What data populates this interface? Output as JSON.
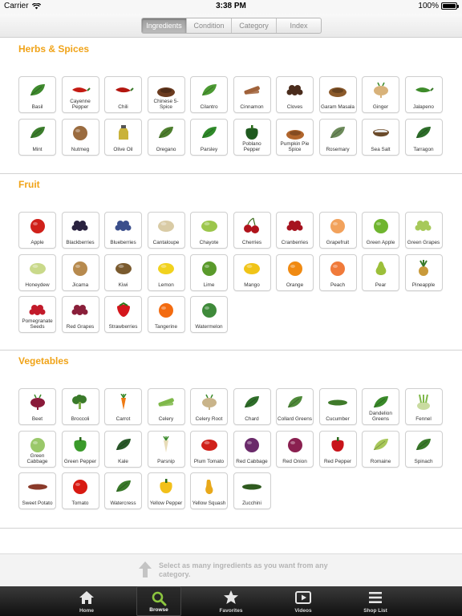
{
  "status": {
    "carrier": "Carrier",
    "time": "3:38 PM",
    "battery": "100%"
  },
  "segments": [
    {
      "label": "Ingredients",
      "active": true
    },
    {
      "label": "Condition",
      "active": false
    },
    {
      "label": "Category",
      "active": false
    },
    {
      "label": "Index",
      "active": false
    }
  ],
  "sections": [
    {
      "title": "Herbs & Spices",
      "items": [
        {
          "label": "Basil",
          "icon": "leaf",
          "color": "#3f8a2e"
        },
        {
          "label": "Cayenne Pepper",
          "icon": "chili",
          "color": "#c41a12"
        },
        {
          "label": "Chili",
          "icon": "chili",
          "color": "#b3160f"
        },
        {
          "label": "Chinese 5-Spice",
          "icon": "powder",
          "color": "#6b3b1f"
        },
        {
          "label": "Cilantro",
          "icon": "leaf",
          "color": "#4c9a33"
        },
        {
          "label": "Cinnamon",
          "icon": "stick",
          "color": "#a0623a"
        },
        {
          "label": "Cloves",
          "icon": "cluster",
          "color": "#4a2c1c"
        },
        {
          "label": "Garam Masala",
          "icon": "powder",
          "color": "#8b5a2b"
        },
        {
          "label": "Ginger",
          "icon": "root",
          "color": "#d8b27a"
        },
        {
          "label": "Jalapeno",
          "icon": "chili",
          "color": "#3d8b2a"
        },
        {
          "label": "Mint",
          "icon": "leaf",
          "color": "#3b7d2c"
        },
        {
          "label": "Nutmeg",
          "icon": "round",
          "color": "#9a6b3f"
        },
        {
          "label": "Olive Oil",
          "icon": "bottle",
          "color": "#c9b23a"
        },
        {
          "label": "Oregano",
          "icon": "leaf",
          "color": "#4e7f2f"
        },
        {
          "label": "Parsley",
          "icon": "leaf",
          "color": "#2f8a2a"
        },
        {
          "label": "Poblano Pepper",
          "icon": "pepper",
          "color": "#1f5a1f"
        },
        {
          "label": "Pumpkin Pie Spice",
          "icon": "powder",
          "color": "#b0652c"
        },
        {
          "label": "Rosemary",
          "icon": "leaf",
          "color": "#6c8a5a"
        },
        {
          "label": "Sea Salt",
          "icon": "bowl",
          "color": "#e6e6e6"
        },
        {
          "label": "Tarragon",
          "icon": "leaf",
          "color": "#2e6e2a"
        }
      ]
    },
    {
      "title": "Fruit",
      "items": [
        {
          "label": "Apple",
          "icon": "round",
          "color": "#d0211a"
        },
        {
          "label": "Blackberries",
          "icon": "cluster",
          "color": "#2a2340"
        },
        {
          "label": "Blueberries",
          "icon": "cluster",
          "color": "#3b4f8c"
        },
        {
          "label": "Cantaloupe",
          "icon": "oval",
          "color": "#d9cba5"
        },
        {
          "label": "Chayote",
          "icon": "oval",
          "color": "#9cc64c"
        },
        {
          "label": "Cherries",
          "icon": "cherry",
          "color": "#b0131b"
        },
        {
          "label": "Cranberries",
          "icon": "cluster",
          "color": "#a6131f"
        },
        {
          "label": "Grapefruit",
          "icon": "round",
          "color": "#f2a25c"
        },
        {
          "label": "Green Apple",
          "icon": "round",
          "color": "#6fb52f"
        },
        {
          "label": "Green Grapes",
          "icon": "cluster",
          "color": "#a7c95a"
        },
        {
          "label": "Honeydew",
          "icon": "oval",
          "color": "#c9d98a"
        },
        {
          "label": "Jicama",
          "icon": "round",
          "color": "#b78a4e"
        },
        {
          "label": "Kiwi",
          "icon": "oval",
          "color": "#7a5a2e"
        },
        {
          "label": "Lemon",
          "icon": "oval",
          "color": "#f1d21e"
        },
        {
          "label": "Lime",
          "icon": "round",
          "color": "#5a9a2b"
        },
        {
          "label": "Mango",
          "icon": "oval",
          "color": "#f0c418"
        },
        {
          "label": "Orange",
          "icon": "round",
          "color": "#f08a12"
        },
        {
          "label": "Peach",
          "icon": "round",
          "color": "#f07a3a"
        },
        {
          "label": "Pear",
          "icon": "pear",
          "color": "#9cbf3a"
        },
        {
          "label": "Pineapple",
          "icon": "pine",
          "color": "#c99a3a"
        },
        {
          "label": "Pomegranate Seeds",
          "icon": "cluster",
          "color": "#c21a2a"
        },
        {
          "label": "Red Grapes",
          "icon": "cluster",
          "color": "#8a1f3a"
        },
        {
          "label": "Strawberries",
          "icon": "berry",
          "color": "#d4161c"
        },
        {
          "label": "Tangerine",
          "icon": "round",
          "color": "#f36b10"
        },
        {
          "label": "Watermelon",
          "icon": "round",
          "color": "#3f8a3a"
        }
      ]
    },
    {
      "title": "Vegetables",
      "items": [
        {
          "label": "Beet",
          "icon": "root",
          "color": "#8a1a3a"
        },
        {
          "label": "Broccoli",
          "icon": "tree",
          "color": "#3a7a2a"
        },
        {
          "label": "Carrot",
          "icon": "carrot",
          "color": "#ef7a12"
        },
        {
          "label": "Celery",
          "icon": "stick",
          "color": "#7fb84a"
        },
        {
          "label": "Celery Root",
          "icon": "root",
          "color": "#c9b48a"
        },
        {
          "label": "Chard",
          "icon": "leaf",
          "color": "#2f6e2a"
        },
        {
          "label": "Collard Greens",
          "icon": "leaf",
          "color": "#4f8a3a"
        },
        {
          "label": "Cucumber",
          "icon": "long",
          "color": "#3f7a2a"
        },
        {
          "label": "Dandelion Greens",
          "icon": "leaf",
          "color": "#3a8a2a"
        },
        {
          "label": "Fennel",
          "icon": "bulb",
          "color": "#c9dba0"
        },
        {
          "label": "Green Cabbage",
          "icon": "round",
          "color": "#9ac86a"
        },
        {
          "label": "Green Pepper",
          "icon": "pepper",
          "color": "#3a9a2a"
        },
        {
          "label": "Kale",
          "icon": "leaf",
          "color": "#2a5a2a"
        },
        {
          "label": "Parsnip",
          "icon": "carrot",
          "color": "#e8dcb8"
        },
        {
          "label": "Plum Tomato",
          "icon": "oval",
          "color": "#d0211a"
        },
        {
          "label": "Red Cabbage",
          "icon": "round",
          "color": "#6a2a6a"
        },
        {
          "label": "Red Onion",
          "icon": "round",
          "color": "#8a2050"
        },
        {
          "label": "Red Pepper",
          "icon": "pepper",
          "color": "#c8141a"
        },
        {
          "label": "Romaine",
          "icon": "leaf",
          "color": "#a8c85a"
        },
        {
          "label": "Spinach",
          "icon": "leaf",
          "color": "#3a7a2a"
        },
        {
          "label": "Sweet Potato",
          "icon": "long",
          "color": "#8a3a2a"
        },
        {
          "label": "Tomato",
          "icon": "round",
          "color": "#d81a12"
        },
        {
          "label": "Watercress",
          "icon": "leaf",
          "color": "#3a7a2a"
        },
        {
          "label": "Yellow Pepper",
          "icon": "pepper",
          "color": "#f2c01a"
        },
        {
          "label": "Yellow Squash",
          "icon": "squash",
          "color": "#e8a81a"
        },
        {
          "label": "Zucchini",
          "icon": "long",
          "color": "#2f5a1f"
        }
      ]
    }
  ],
  "hint": {
    "text": "Select as many ingredients as you want from any category.",
    "icon": "up-arrow-icon"
  },
  "tabs": [
    {
      "label": "Home",
      "icon": "home",
      "active": false
    },
    {
      "label": "Browse",
      "icon": "search",
      "active": true
    },
    {
      "label": "Favorites",
      "icon": "star",
      "active": false
    },
    {
      "label": "Videos",
      "icon": "play",
      "active": false
    },
    {
      "label": "Shop List",
      "icon": "list",
      "active": false
    }
  ],
  "colors": {
    "accent": "#f0a318",
    "tabbar": "#1c1c1c",
    "browse_icon": "#8cc63f"
  }
}
